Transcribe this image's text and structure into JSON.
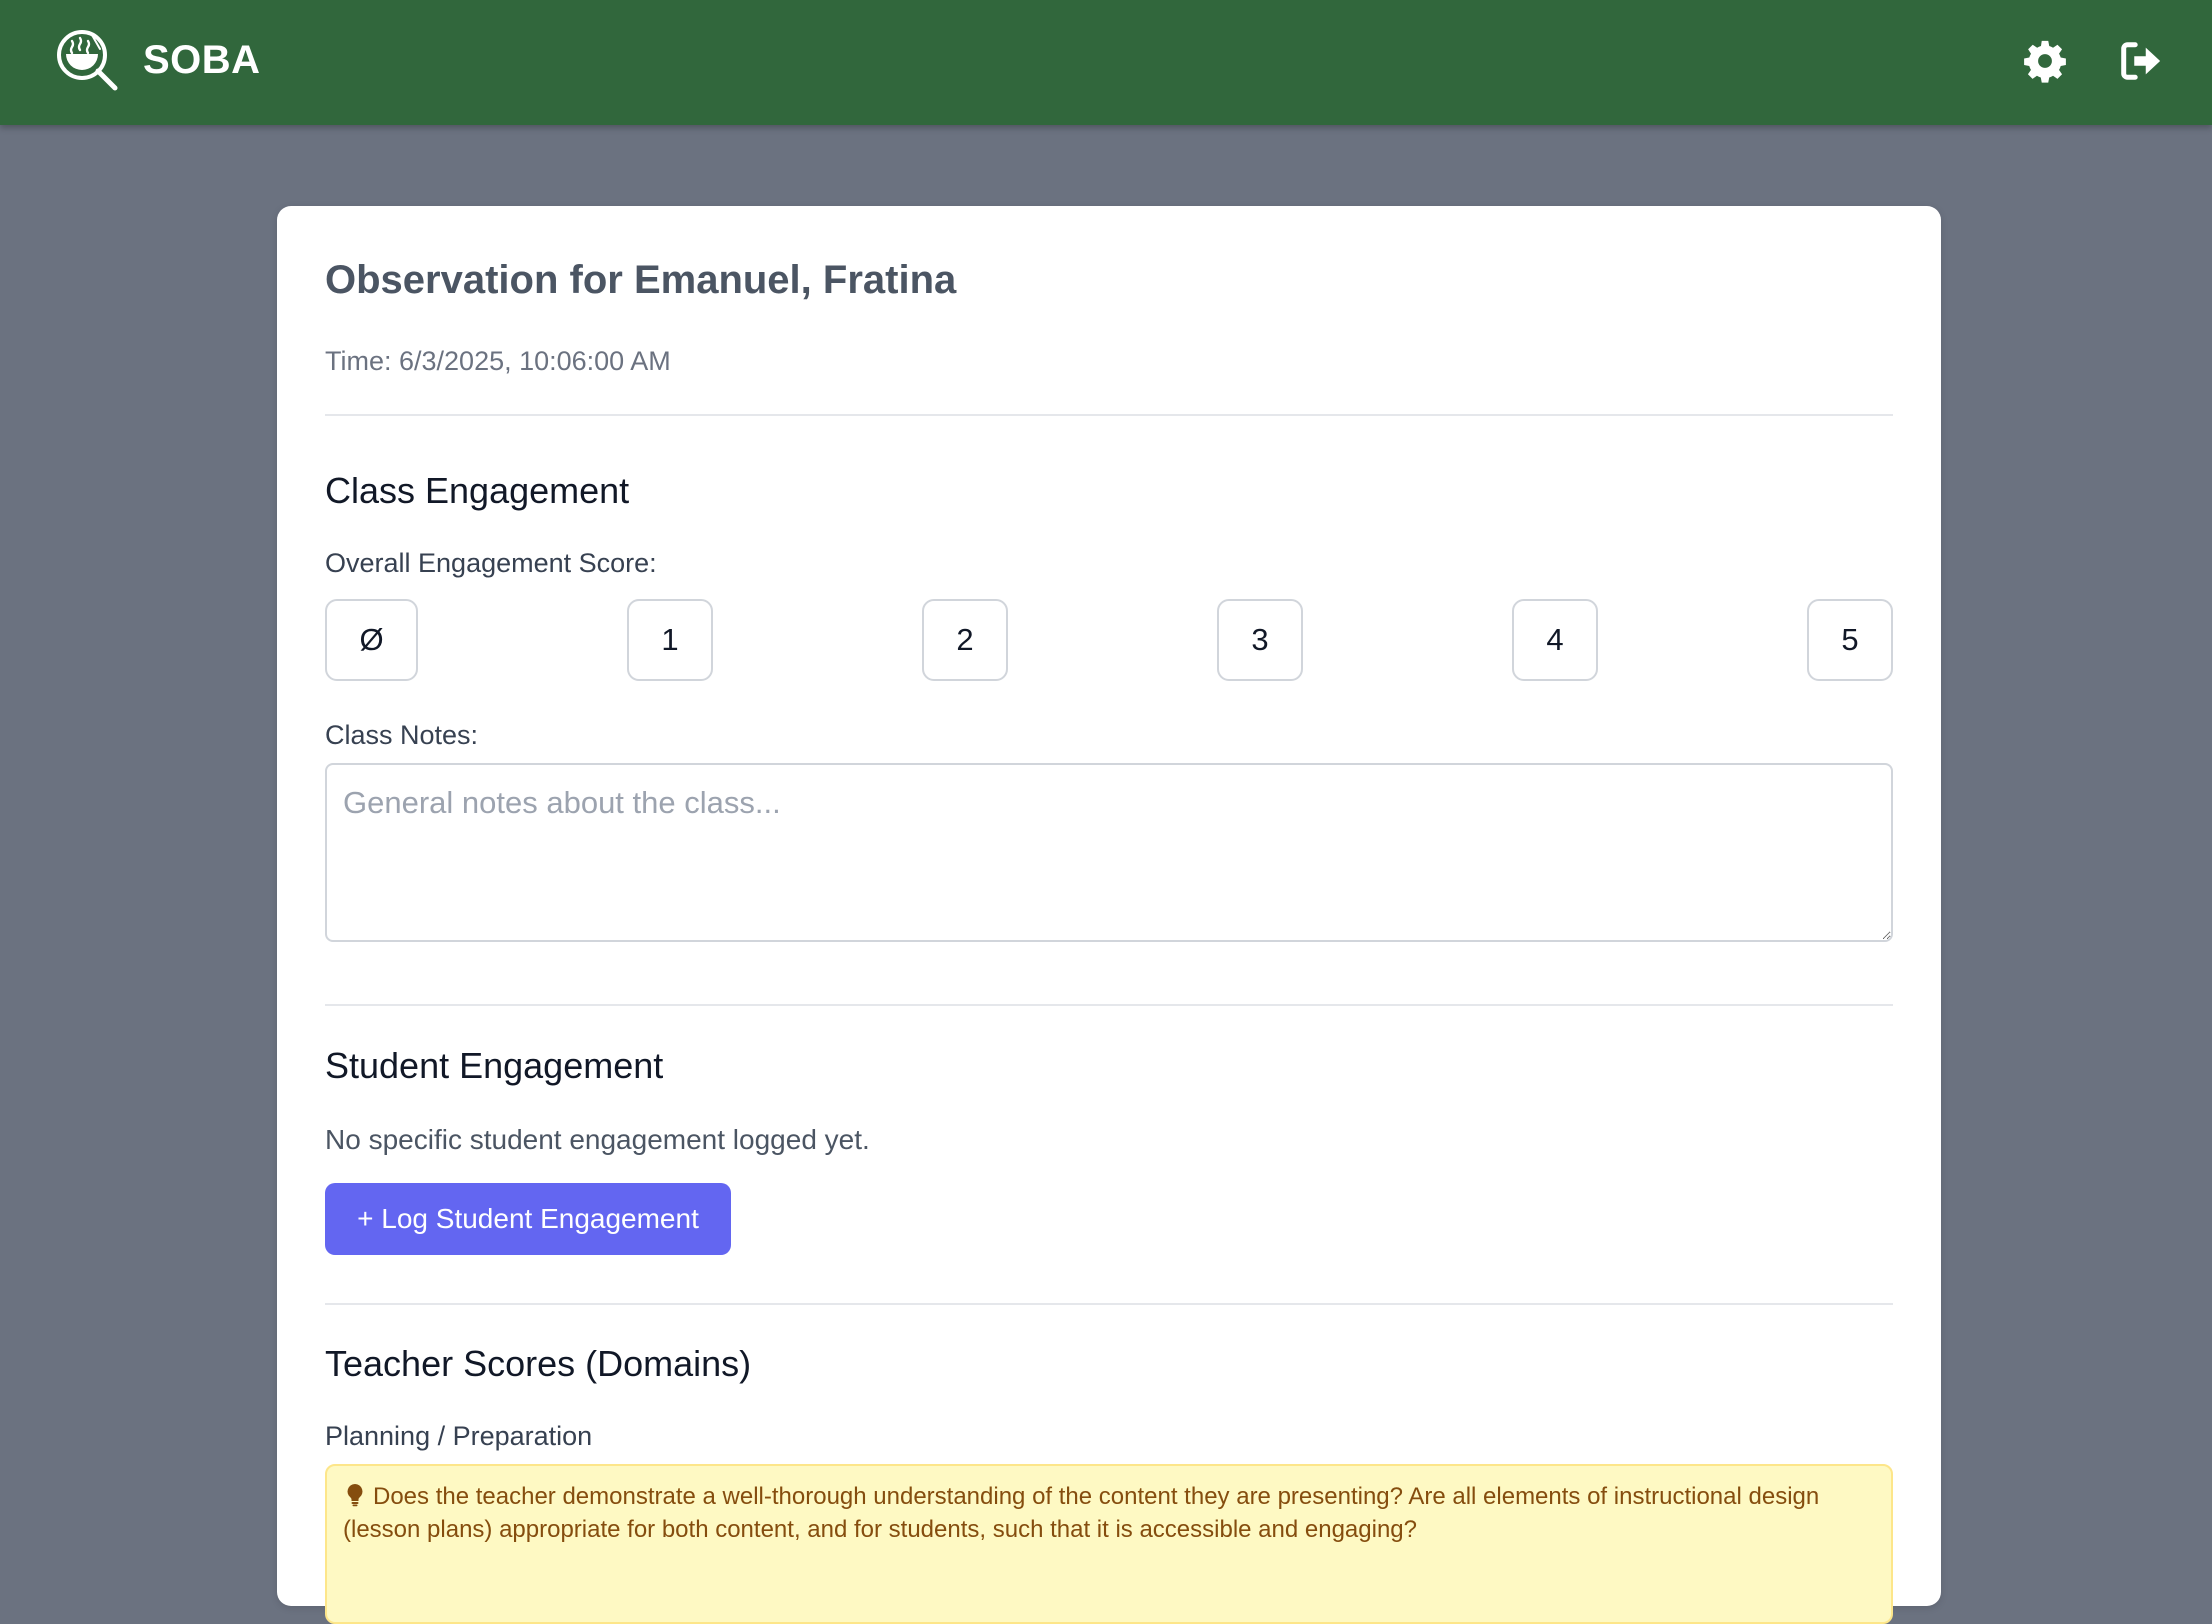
{
  "app": {
    "name": "SOBA",
    "logo_icon": "ramen-magnifier-icon",
    "header_color": "#31673c",
    "settings_icon": "gear-icon",
    "logout_icon": "sign-out-icon"
  },
  "observation": {
    "title": "Observation for Emanuel, Fratina",
    "time": "Time: 6/3/2025, 10:06:00 AM"
  },
  "class_engagement": {
    "heading": "Class Engagement",
    "score_label": "Overall Engagement Score:",
    "score_options": [
      "Ø",
      "1",
      "2",
      "3",
      "4",
      "5"
    ],
    "notes_label": "Class Notes:",
    "notes_placeholder": "General notes about the class...",
    "notes_value": ""
  },
  "student_engagement": {
    "heading": "Student Engagement",
    "empty_text": "No specific student engagement logged yet.",
    "log_button": "+ Log Student Engagement",
    "button_color": "#6366f1"
  },
  "teacher_scores": {
    "heading": "Teacher Scores (Domains)",
    "domain_label": "Planning / Preparation",
    "tip_icon": "lightbulb-icon",
    "tip_text": "Does the teacher demonstrate a well-thorough understanding of the content they are presenting? Are all elements of instructional design (lesson plans) appropriate for both content, and for students, such that it is accessible and engaging?"
  }
}
